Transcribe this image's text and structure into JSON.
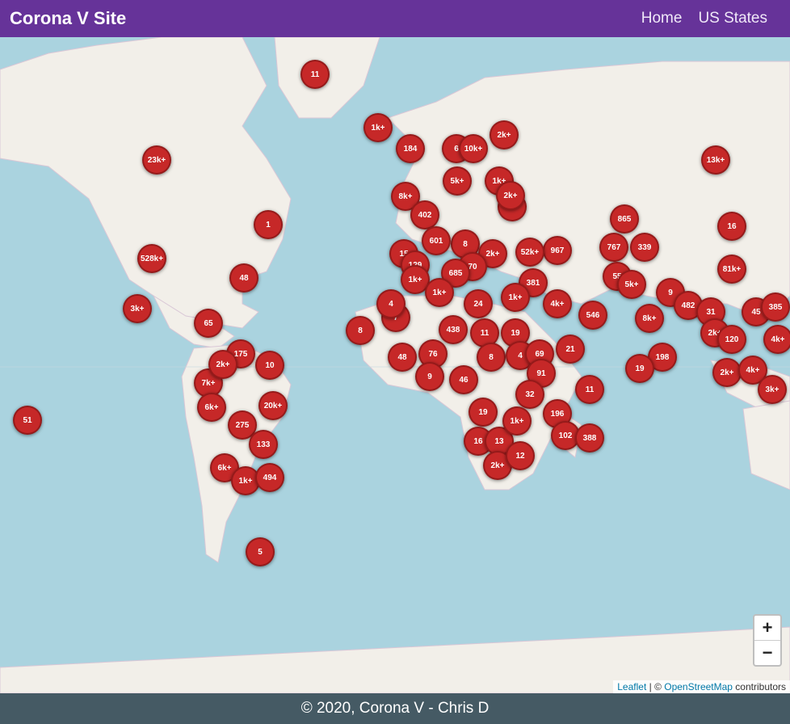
{
  "navbar": {
    "brand": "Corona V Site",
    "links": [
      "Home",
      "US States"
    ]
  },
  "map": {
    "zoom_in_label": "+",
    "zoom_out_label": "−",
    "attribution": {
      "leaflet": "Leaflet",
      "separator": " | © ",
      "osm": "OpenStreetMap",
      "suffix": " contributors"
    },
    "markers": [
      "11",
      "1k+",
      "184",
      "6",
      "10k+",
      "2k+",
      "23k+",
      "13k+",
      "5k+",
      "1k+",
      "8k+",
      "3k+",
      "2k+",
      "865",
      "1",
      "16",
      "402",
      "8",
      "601",
      "967",
      "767",
      "339",
      "528k+",
      "15",
      "2k+",
      "52k+",
      "129",
      "70",
      "685",
      "1k+",
      "81k+",
      "48",
      "381",
      "55",
      "5k+",
      "1k+",
      "1k+",
      "9",
      "3k+",
      "4k+",
      "482",
      "31",
      "45",
      "385",
      "65",
      "24",
      "546",
      "8k+",
      "2k+",
      "120",
      "4k+",
      "438",
      "11",
      "19",
      "8",
      "7",
      "21",
      "198",
      "19",
      "2k+",
      "4k+",
      "175",
      "10",
      "76",
      "48",
      "8",
      "4",
      "69",
      "7k+",
      "9",
      "46",
      "91",
      "3k+",
      "6k+",
      "20k+",
      "32",
      "11",
      "51",
      "19",
      "196",
      "275",
      "16",
      "13",
      "102",
      "388",
      "133",
      "2k+",
      "12",
      "6k+",
      "1k+",
      "494",
      "5",
      "4",
      "1k+",
      "2k+"
    ]
  },
  "footer": {
    "text": "© 2020, Corona V - Chris D"
  }
}
